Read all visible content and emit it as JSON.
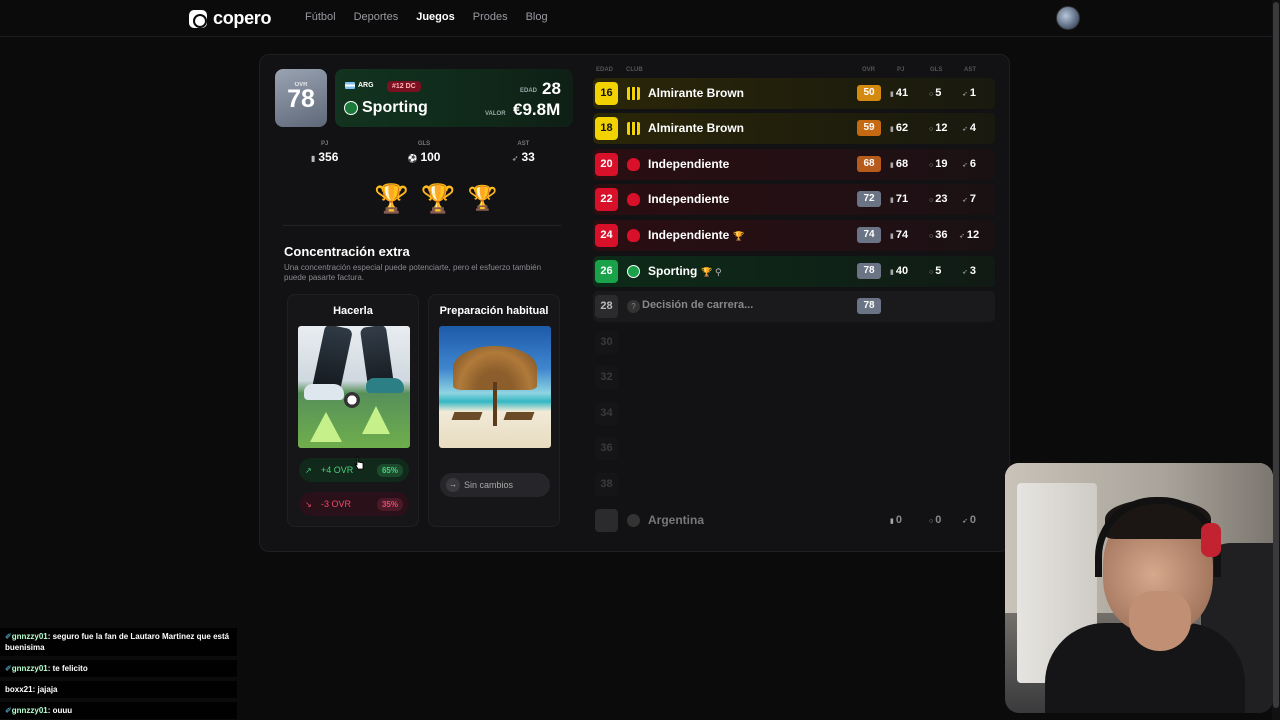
{
  "nav": {
    "logo": "copero",
    "links": [
      "Fútbol",
      "Deportes",
      "Juegos",
      "Prodes",
      "Blog"
    ],
    "active": "Juegos"
  },
  "player": {
    "ovr_label": "OVR",
    "ovr": "78",
    "nation": "ARG",
    "number_pos": "#12 DC",
    "club": "Sporting",
    "edad_label": "EDAD",
    "edad": "28",
    "valor_label": "VALOR",
    "valor": "€9.8M",
    "stats": [
      {
        "key": "PJ",
        "value": "356",
        "icon": "boot-icon"
      },
      {
        "key": "GLS",
        "value": "100",
        "icon": "ball-icon"
      },
      {
        "key": "AST",
        "value": "33",
        "icon": "assist-icon"
      }
    ]
  },
  "event": {
    "title": "Concentración extra",
    "description": "Una concentración especial puede potenciarte, pero el esfuerzo también puede pasarte factura.",
    "options": [
      {
        "title": "Hacerla",
        "outcomes": [
          {
            "label": "+4 OVR",
            "pct": "65%"
          },
          {
            "label": "-3 OVR",
            "pct": "35%"
          }
        ]
      },
      {
        "title": "Preparación habitual",
        "outcomes": [
          {
            "label": "Sin cambios"
          }
        ]
      }
    ]
  },
  "table": {
    "headers": {
      "edad": "EDAD",
      "club": "CLUB",
      "ovr": "OVR",
      "pj": "PJ",
      "gls": "GLS",
      "ast": "AST"
    },
    "rows": [
      {
        "age": "16",
        "club": "Almirante Brown",
        "ovr": "50",
        "pj": "41",
        "gls": "5",
        "ast": "1"
      },
      {
        "age": "18",
        "club": "Almirante Brown",
        "ovr": "59",
        "pj": "62",
        "gls": "12",
        "ast": "4"
      },
      {
        "age": "20",
        "club": "Independiente",
        "ovr": "68",
        "pj": "68",
        "gls": "19",
        "ast": "6"
      },
      {
        "age": "22",
        "club": "Independiente",
        "ovr": "72",
        "pj": "71",
        "gls": "23",
        "ast": "7"
      },
      {
        "age": "24",
        "club": "Independiente",
        "ovr": "74",
        "pj": "74",
        "gls": "36",
        "ast": "12"
      },
      {
        "age": "26",
        "club": "Sporting",
        "ovr": "78",
        "pj": "40",
        "gls": "5",
        "ast": "3"
      },
      {
        "age": "28",
        "club": "Decisión de carrera...",
        "ovr": "78"
      }
    ],
    "empty_ages": [
      "30",
      "32",
      "34",
      "36",
      "38"
    ],
    "national": {
      "name": "Argentina",
      "pj": "0",
      "gls": "0",
      "ast": "0"
    }
  },
  "chat": [
    {
      "user": "gnnzzy01",
      "text": "seguro fue la fan de Lautaro Martinez que está buenisima",
      "badge": true
    },
    {
      "user": "gnnzzy01",
      "text": "te felicito",
      "badge": true
    },
    {
      "user": "boxx21",
      "text": "jajaja",
      "badge": false
    },
    {
      "user": "gnnzzy01",
      "text": "ouuu",
      "badge": true
    }
  ],
  "colors": {
    "bg": "#0b0b0c",
    "card": "#121214",
    "yellow": "#f2d200",
    "red": "#d8102a",
    "green": "#1aa24a",
    "positive": "#4ad07a",
    "negative": "#ef4a6a"
  }
}
